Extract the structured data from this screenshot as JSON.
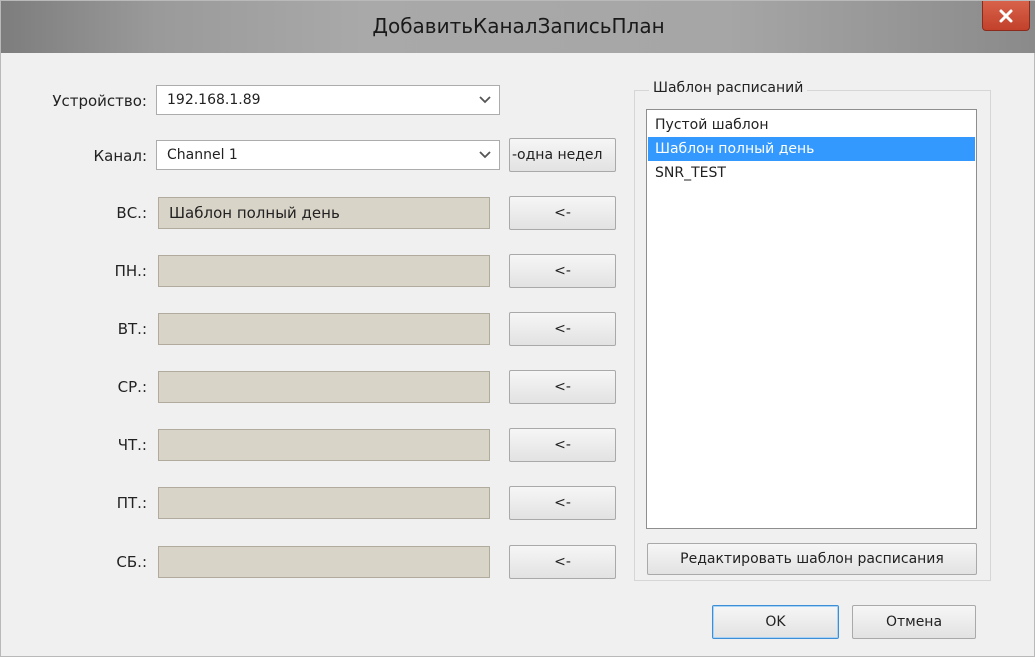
{
  "window": {
    "title": "ДобавитьКаналЗаписьПлан"
  },
  "device": {
    "label": "Устройство:",
    "value": "192.168.1.89"
  },
  "channel": {
    "label": "Канал:",
    "value": "Channel 1",
    "week_button": "-одна недел"
  },
  "days": [
    {
      "label": "ВС.:",
      "value": "Шаблон полный день",
      "button": "<-"
    },
    {
      "label": "ПН.:",
      "value": "",
      "button": "<-"
    },
    {
      "label": "ВТ.:",
      "value": "",
      "button": "<-"
    },
    {
      "label": "СР.:",
      "value": "",
      "button": "<-"
    },
    {
      "label": "ЧТ.:",
      "value": "",
      "button": "<-"
    },
    {
      "label": "ПТ.:",
      "value": "",
      "button": "<-"
    },
    {
      "label": "СБ.:",
      "value": "",
      "button": "<-"
    }
  ],
  "templates": {
    "title": "Шаблон расписаний",
    "items": [
      "Пустой шаблон",
      "Шаблон полный день",
      "SNR_TEST"
    ],
    "selected_index": 1,
    "edit_button": "Редактировать шаблон расписания"
  },
  "buttons": {
    "ok": "OK",
    "cancel": "Отмена"
  },
  "colors": {
    "selection": "#3399ff",
    "close_button": "#c94a33",
    "field_background": "#d9d4c8"
  },
  "icons": {
    "close": "close-icon",
    "dropdown": "chevron-down-icon"
  }
}
